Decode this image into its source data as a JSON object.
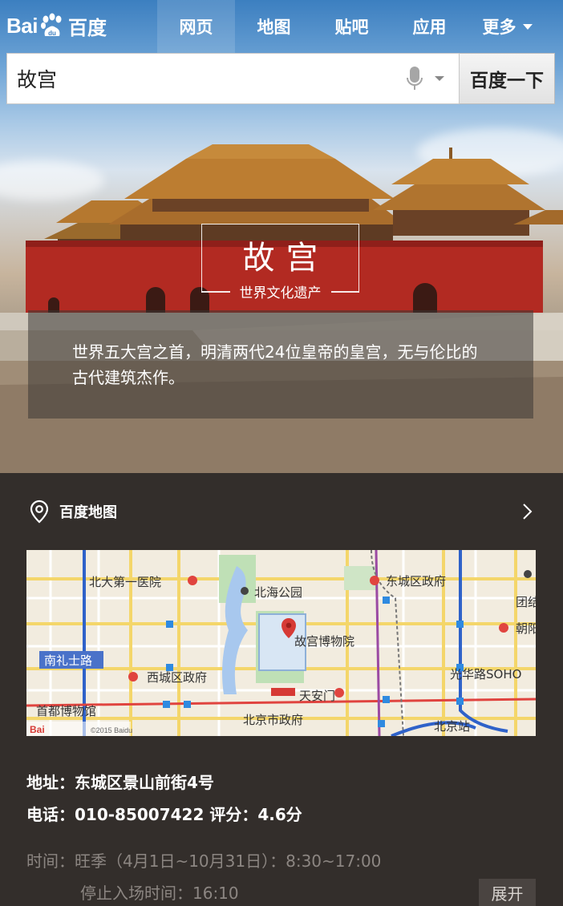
{
  "brand": {
    "logo_left": "Bai",
    "logo_right": "百度"
  },
  "nav": {
    "items": [
      {
        "label": "网页"
      },
      {
        "label": "地图"
      },
      {
        "label": "贴吧"
      },
      {
        "label": "应用"
      },
      {
        "label": "更多"
      }
    ]
  },
  "search": {
    "query": "故宫",
    "button_label": "百度一下",
    "mic_icon": "microphone-icon"
  },
  "hero": {
    "title": "故宫",
    "subtitle": "世界文化遗产",
    "description": "世界五大宫之首，明清两代24位皇帝的皇宫，无与伦比的古代建筑杰作。"
  },
  "map_card": {
    "label": "百度地图",
    "labels": {
      "hospital": "北大第一医院",
      "park": "北海公园",
      "dongcheng_gov": "东城区政府",
      "tuan": "团结",
      "chaoyang": "朝阳",
      "museum": "故宫博物院",
      "nanlishi": "南礼士路",
      "xicheng_gov": "西城区政府",
      "guanghua": "光华路SOHO",
      "tiananmen": "天安门",
      "shoudu_museum": "首都博物馆",
      "beijing_gov": "北京市政府",
      "beijing_station": "北京站",
      "copyright": "©2015 Baidu"
    }
  },
  "info": {
    "address": "地址：东城区景山前街4号",
    "phone_rating": "电话：010-85007422  评分：4.6分",
    "hours": "时间：旺季（4月1日~10月31日）：8:30~17:00",
    "last_entry": "停止入场时间：16:10",
    "expand_label": "展开"
  },
  "colors": {
    "panel_bg": "#332e2b",
    "wall_red": "#b22a22",
    "roof_gold": "#b8772c"
  }
}
